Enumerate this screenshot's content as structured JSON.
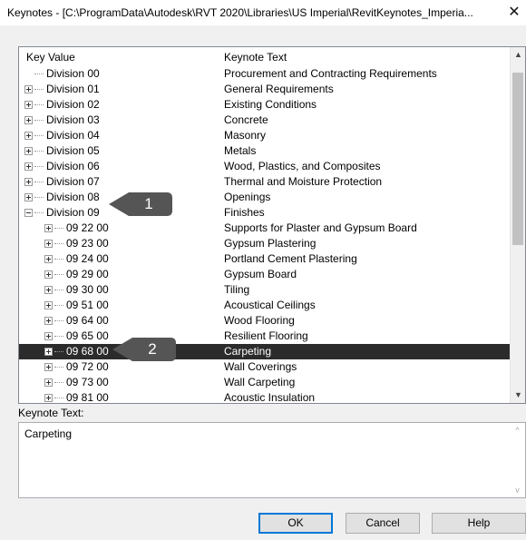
{
  "window": {
    "title": "Keynotes - [C:\\ProgramData\\Autodesk\\RVT 2020\\Libraries\\US Imperial\\RevitKeynotes_Imperia...",
    "close_icon": "close-icon"
  },
  "tree": {
    "col_key": "Key Value",
    "col_text": "Keynote Text",
    "rows": [
      {
        "key": "Division 00",
        "text": "Procurement and Contracting Requirements",
        "level": 0,
        "expander": "none"
      },
      {
        "key": "Division 01",
        "text": "General Requirements",
        "level": 0,
        "expander": "plus"
      },
      {
        "key": "Division 02",
        "text": "Existing Conditions",
        "level": 0,
        "expander": "plus"
      },
      {
        "key": "Division 03",
        "text": "Concrete",
        "level": 0,
        "expander": "plus"
      },
      {
        "key": "Division 04",
        "text": "Masonry",
        "level": 0,
        "expander": "plus"
      },
      {
        "key": "Division 05",
        "text": "Metals",
        "level": 0,
        "expander": "plus"
      },
      {
        "key": "Division 06",
        "text": "Wood, Plastics, and Composites",
        "level": 0,
        "expander": "plus"
      },
      {
        "key": "Division 07",
        "text": "Thermal and Moisture Protection",
        "level": 0,
        "expander": "plus"
      },
      {
        "key": "Division 08",
        "text": "Openings",
        "level": 0,
        "expander": "plus"
      },
      {
        "key": "Division 09",
        "text": "Finishes",
        "level": 0,
        "expander": "minus"
      },
      {
        "key": "09 22 00",
        "text": "Supports for Plaster and Gypsum Board",
        "level": 1,
        "expander": "plus"
      },
      {
        "key": "09 23 00",
        "text": "Gypsum Plastering",
        "level": 1,
        "expander": "plus"
      },
      {
        "key": "09 24 00",
        "text": "Portland Cement Plastering",
        "level": 1,
        "expander": "plus"
      },
      {
        "key": "09 29 00",
        "text": "Gypsum Board",
        "level": 1,
        "expander": "plus"
      },
      {
        "key": "09 30 00",
        "text": "Tiling",
        "level": 1,
        "expander": "plus"
      },
      {
        "key": "09 51 00",
        "text": "Acoustical Ceilings",
        "level": 1,
        "expander": "plus"
      },
      {
        "key": "09 64 00",
        "text": "Wood Flooring",
        "level": 1,
        "expander": "plus"
      },
      {
        "key": "09 65 00",
        "text": "Resilient Flooring",
        "level": 1,
        "expander": "plus"
      },
      {
        "key": "09 68 00",
        "text": "Carpeting",
        "level": 1,
        "expander": "plus",
        "selected": true
      },
      {
        "key": "09 72 00",
        "text": "Wall Coverings",
        "level": 1,
        "expander": "plus"
      },
      {
        "key": "09 73 00",
        "text": "Wall Carpeting",
        "level": 1,
        "expander": "plus"
      },
      {
        "key": "09 81 00",
        "text": "Acoustic Insulation",
        "level": 1,
        "expander": "plus"
      }
    ]
  },
  "keynote_text": {
    "label": "Keynote Text:",
    "value": "Carpeting"
  },
  "buttons": {
    "ok": "OK",
    "cancel": "Cancel",
    "help": "Help"
  },
  "callouts": [
    {
      "number": "1"
    },
    {
      "number": "2"
    }
  ],
  "colors": {
    "selection": "#2b2b2b",
    "callout": "#555555",
    "ok_border": "#0078d7"
  }
}
